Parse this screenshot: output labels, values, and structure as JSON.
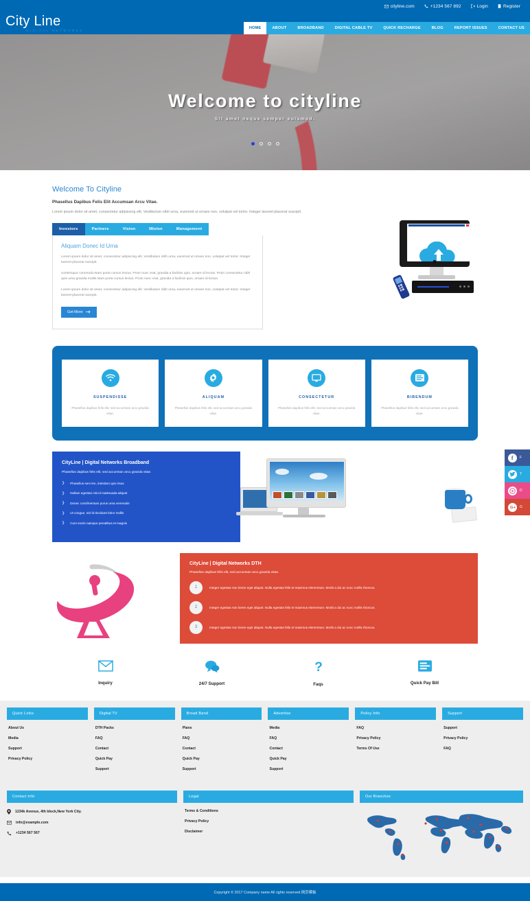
{
  "topbar": {
    "email": "cityline.com",
    "phone": "+1234 567 892",
    "login": "Login",
    "register": "Register"
  },
  "header": {
    "logo_main": "City Line",
    "logo_sub": "DIGITAL NETWORKS",
    "nav": [
      {
        "label": "HOME",
        "active": true
      },
      {
        "label": "ABOUT",
        "active": false
      },
      {
        "label": "BROADBAND",
        "active": false
      },
      {
        "label": "DIGITAL CABLE TV",
        "active": false
      },
      {
        "label": "QUICK RECHARGE",
        "active": false
      },
      {
        "label": "BLOG",
        "active": false
      },
      {
        "label": "REPORT ISSUES",
        "active": false
      },
      {
        "label": "CONTACT US",
        "active": false
      }
    ]
  },
  "hero": {
    "title": "Welcome to cityline",
    "subtitle": "Sit amet neque semper euismod.",
    "dots_count": 4,
    "active_dot": 1
  },
  "welcome": {
    "heading": "Welcome To Cityline",
    "lead": "Phasellus Dapibus Felis Elit Accumsan Arcu Vitae.",
    "description": "Lorem ipsum dolor sit amet, consectetur adipiscing elit. Vestibulum nibh urna, euismod ut ornare non, volutpat vel tortor. Integer laoreet placerat suscipit.",
    "tabs": [
      {
        "label": "Investors",
        "active": true
      },
      {
        "label": "Partners",
        "active": false
      },
      {
        "label": "Vision",
        "active": false
      },
      {
        "label": "Mision",
        "active": false
      },
      {
        "label": "Management",
        "active": false
      }
    ],
    "panel": {
      "heading": "Aliquam Donec Id Urna",
      "p1": "Lorem ipsum dolor sit amet, consectetur adipiscing elit. Vestibulum nibh urna, euismod ut ornare non, volutpat vel tortor. Integer laoreet placerat suscipit.",
      "p2": "scelerisque commodo.Nam porta cursus lectus. Proin nunc erat, gravida a facilisis quis, ornare id lectus. Proin consectetur nibh quis urna gravida mollis.Nam porta cursus lectus. Proin nunc erat, gravida a facilisis quis, ornare id lectus.",
      "p3": "Lorem ipsum dolor sit amet, consectetur adipiscing elit. Vestibulum nibh urna, euismod ut ornare non, volutpat vel tortor. Integer laoreet placerat suscipit.",
      "button": "Get More"
    }
  },
  "features": [
    {
      "title": "SUSPENDISSE",
      "text": "Phasellus dapibus felis elit, sed accumsan arcu gravida vitae.",
      "icon": "wifi-icon"
    },
    {
      "title": "ALIQUAM",
      "text": "Phasellus dapibus felis elit, sed accumsan arcu gravida vitae.",
      "icon": "gear-icon"
    },
    {
      "title": "CONSECTETUR",
      "text": "Phasellus dapibus felis elit, sed accumsan arcu gravida vitae.",
      "icon": "monitor-icon"
    },
    {
      "title": "BIBENDUM",
      "text": "Phasellus dapibus felis elit, sed accumsan arcu gravida vitae.",
      "icon": "server-icon"
    }
  ],
  "broadband": {
    "heading": "CityLine | Digital Networks Broadband",
    "subtitle": "Phasellus dapibus felis elit, sed accumsan arcu gravida vitae.",
    "items": [
      "Phasellus sem leo, interdum quis risus",
      "Nullam egestas nisi id malesuada aliquet",
      "Donec condimentum purus urna venenatis",
      "Ut congue, nisl id tincidunt lobor mollis",
      "Cum sociis natoque penatibus et magnis"
    ]
  },
  "dth": {
    "heading": "CityLine | Digital Networks DTH",
    "subtitle": "Phasellus dapibus felis elit, sed accumsan arcu gravida vitae.",
    "items": [
      {
        "num": "1",
        "text": "Integer egestas non lorem eget aliquet. Nulla egestas felis et maximus elementum. Morbi a dui ac nunc mollis rhoncus."
      },
      {
        "num": "2",
        "text": "Integer egestas non lorem eget aliquet. Nulla egestas felis et maximus elementum. Morbi a dui ac nunc mollis rhoncus."
      },
      {
        "num": "3",
        "text": "Integer egestas non lorem eget aliquet. Nulla egestas felis et maximus elementum. Morbi a dui ac nunc mollis rhoncus."
      }
    ]
  },
  "services": [
    {
      "label": "Inquiry",
      "icon": "envelope-icon"
    },
    {
      "label": "24/7 Support",
      "icon": "chat-bubbles-icon"
    },
    {
      "label": "Faqs",
      "icon": "question-mark-icon"
    },
    {
      "label": "Quick Pay Bill",
      "icon": "list-icon"
    }
  ],
  "footer_columns": [
    {
      "title": "Quick Links",
      "items": [
        "About Us",
        "Media",
        "Support",
        "Privacy Policy"
      ]
    },
    {
      "title": "Digital TV",
      "items": [
        "DTH Packs",
        "FAQ",
        "Contact",
        "Quick Pay",
        "Support"
      ]
    },
    {
      "title": "Broad Band",
      "items": [
        "Plans",
        "FAQ",
        "Contact",
        "Quick Pay",
        "Support"
      ]
    },
    {
      "title": "Advertise",
      "items": [
        "Media",
        "FAQ",
        "Contact",
        "Quick Pay",
        "Support"
      ]
    },
    {
      "title": "Policy Info",
      "items": [
        "FAQ",
        "Privacy Policy",
        "Terms Of Use"
      ]
    },
    {
      "title": "Support",
      "items": [
        "Support",
        "Privacy Policy",
        "FAQ"
      ]
    }
  ],
  "footer_bottom": {
    "contact_title": "Contact Info",
    "contact_items": [
      {
        "icon": "location-pin-icon",
        "text": "1234k Avenue, 4th block,New York City."
      },
      {
        "icon": "envelope-icon",
        "text": "info@example.com"
      },
      {
        "icon": "phone-icon",
        "text": "+1234 567 567"
      }
    ],
    "legal_title": "Legal",
    "legal_items": [
      "Terms & Conditions",
      "Privacy Policy",
      "Disclaimer"
    ],
    "branches_title": "Our Branches"
  },
  "copyright": "Copyright © 2017 Company name All rights reserved 网页模板",
  "social": [
    {
      "name": "facebook",
      "glyph": "f",
      "label": "F",
      "color": "#3b5998"
    },
    {
      "name": "twitter",
      "glyph": "t",
      "label": "T",
      "color": "#29abe2"
    },
    {
      "name": "dribbble",
      "glyph": "d",
      "label": "D",
      "color": "#ea4c89"
    },
    {
      "name": "googleplus",
      "glyph": "G+",
      "label": "G",
      "color": "#d34836"
    }
  ],
  "colors": {
    "brand_dark": "#0069b4",
    "brand_light": "#29abe2",
    "accent_blue": "#2254c8",
    "accent_red": "#dd4b39",
    "accent_pink": "#e8417f"
  }
}
